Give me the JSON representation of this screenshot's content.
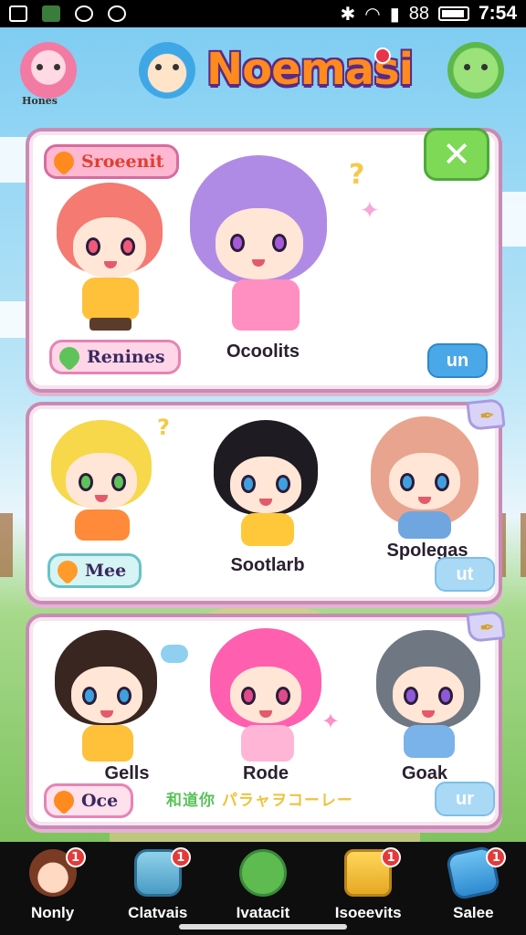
{
  "status_bar": {
    "time": "7:54",
    "battery_text": "88"
  },
  "header": {
    "title": "Noemasi",
    "left_avatar_label": "Hones"
  },
  "panel1": {
    "tag_label": "Sroeenit",
    "pill_label": "Renines",
    "character_name": "Ocoolits",
    "button_label": "un",
    "close_icon": "x-icon"
  },
  "panel2": {
    "pill_label": "Mee",
    "characters": [
      "Sootlarb",
      "Spolegas"
    ],
    "button_label": "ut"
  },
  "panel3": {
    "pill_label": "Oce",
    "characters": [
      "Gells",
      "Rode",
      "Goak"
    ],
    "mixed_text_green": "和道你",
    "mixed_text_yellow": "パラャヲコーレー",
    "button_label": "ur"
  },
  "bottom_nav": [
    {
      "label": "Nonly",
      "badge": "1",
      "icon": "avatar-icon"
    },
    {
      "label": "Clatvais",
      "badge": "1",
      "icon": "box-icon"
    },
    {
      "label": "Ivatacit",
      "badge": "",
      "icon": "chat-icon"
    },
    {
      "label": "Isoeevits",
      "badge": "1",
      "icon": "coin-icon"
    },
    {
      "label": "Salee",
      "badge": "1",
      "icon": "house-icon"
    }
  ],
  "colors": {
    "accent_title": "#ff8a1e",
    "panel_border": "#c88bb5",
    "close_green": "#7ed957",
    "button_blue": "#4aa8e8"
  }
}
